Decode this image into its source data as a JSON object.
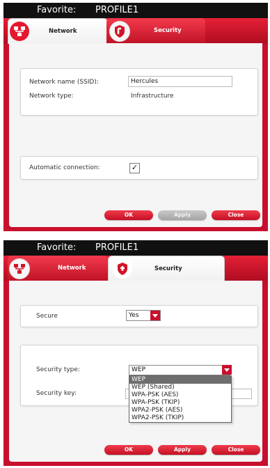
{
  "screen1": {
    "favorite_label": "Favorite:",
    "profile_name": "PROFILE1",
    "tabs": {
      "network": "Network",
      "security": "Security"
    },
    "network_name_label": "Network name (SSID):",
    "network_name_value": "Hercules",
    "network_type_label": "Network type:",
    "network_type_value": "Infrastructure",
    "auto_connection_label": "Automatic connection:",
    "auto_connection_checked": "✓",
    "buttons": {
      "ok": "OK",
      "apply": "Apply",
      "close": "Close"
    }
  },
  "screen2": {
    "favorite_label": "Favorite:",
    "profile_name": "PROFILE1",
    "tabs": {
      "network": "Network",
      "security": "Security"
    },
    "secure_label": "Secure",
    "secure_value": "Yes",
    "security_type_label": "Security type:",
    "security_type_value": "WEP",
    "security_type_options": [
      "WEP",
      "WEP (Shared)",
      "WPA-PSK (AES)",
      "WPA-PSK (TKIP)",
      "WPA2-PSK (AES)",
      "WPA2-PSK (TKIP)"
    ],
    "security_key_label": "Security key:",
    "buttons": {
      "ok": "OK",
      "apply": "Apply",
      "close": "Close"
    }
  },
  "colors": {
    "brand_red": "#c8102e",
    "title_bar": "#111111",
    "disabled_button": "#b5b5b5"
  }
}
